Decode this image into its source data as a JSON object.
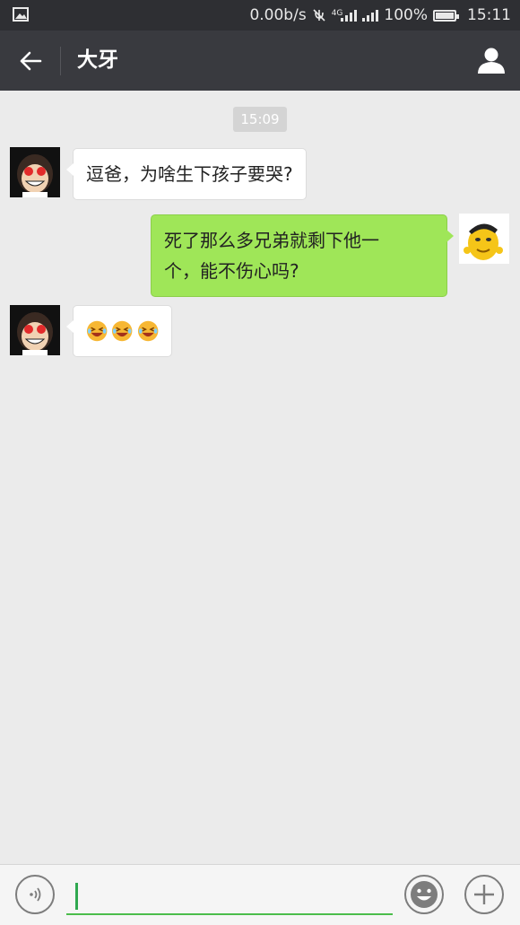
{
  "status_bar": {
    "net_speed": "0.00b/s",
    "network_type": "4G",
    "battery": "100%",
    "time": "15:11",
    "icons": [
      "image-icon",
      "mute-icon",
      "signal-icon",
      "signal-icon",
      "battery-icon"
    ]
  },
  "header": {
    "title": "大牙",
    "back_icon": "arrow-left-icon",
    "profile_icon": "person-icon"
  },
  "chat": {
    "timestamp": "15:09",
    "messages": [
      {
        "side": "left",
        "sender_avatar": "monkey-avatar",
        "text": "逗爸，为啥生下孩子要哭?"
      },
      {
        "side": "right",
        "sender_avatar": "cartoon-face-avatar",
        "text_line1": "死了那么多兄弟就剩下他一",
        "text_line2": "个，能不伤心吗?"
      },
      {
        "side": "left",
        "sender_avatar": "monkey-avatar",
        "emojis": [
          "laughing-emoji",
          "laughing-emoji",
          "laughing-emoji"
        ]
      }
    ]
  },
  "input_bar": {
    "text_value": "",
    "voice_icon": "voice-icon",
    "emoji_icon": "smiley-icon",
    "plus_icon": "plus-icon"
  },
  "colors": {
    "status_bar_bg": "#2e2f33",
    "title_bar_bg": "#393a3f",
    "chat_bg": "#ebebeb",
    "sent_bubble": "#9fe658",
    "received_bubble": "#ffffff",
    "input_accent": "#4bbd4b"
  }
}
